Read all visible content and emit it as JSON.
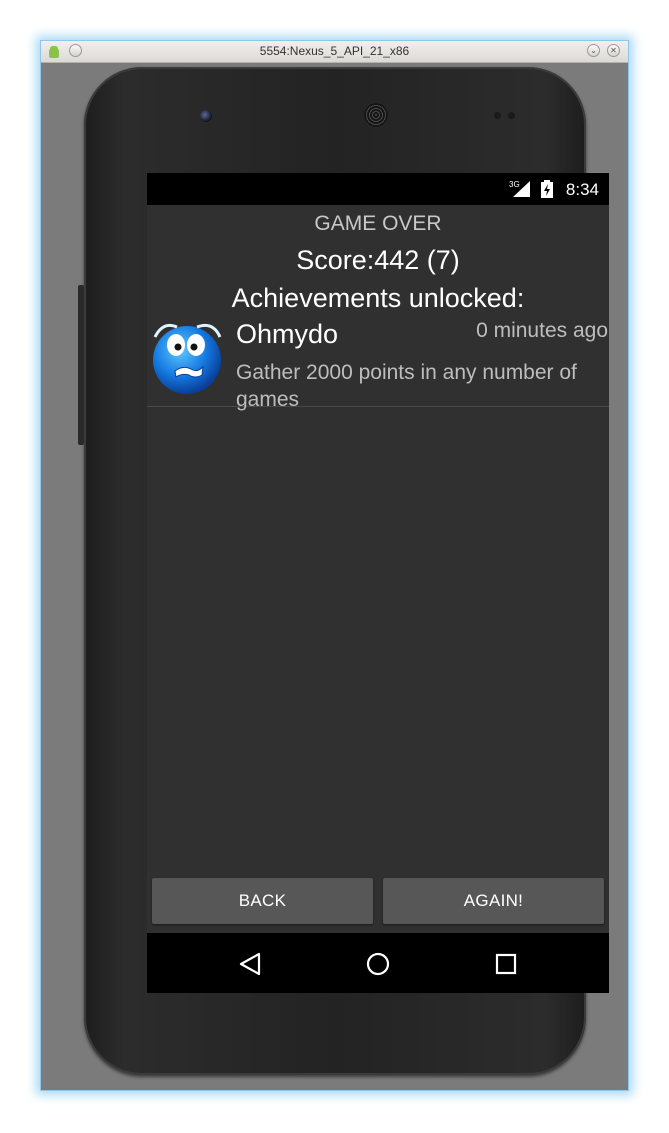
{
  "window": {
    "title": "5554:Nexus_5_API_21_x86",
    "icons": [
      "android-icon",
      "menu-circle-icon",
      "minimize-icon",
      "close-icon"
    ]
  },
  "status_bar": {
    "network": "3G",
    "time": "8:34",
    "icons": [
      "signal-icon",
      "battery-icon"
    ]
  },
  "game": {
    "heading": "GAME OVER",
    "score": "Score:442 (7)",
    "achievements_title": "Achievements unlocked:"
  },
  "achievements": [
    {
      "name": "Ohmydo",
      "time": "0 minutes ago",
      "description_line1": "Gather 2000 points in any number of",
      "description_line2": "games",
      "icon": "worried-smiley-icon"
    }
  ],
  "buttons": {
    "back": "BACK",
    "again": "AGAIN!"
  },
  "nav_bar": {
    "icons": [
      "back-triangle-icon",
      "home-circle-icon",
      "recents-square-icon"
    ]
  },
  "colors": {
    "screen_bg": "#303030",
    "button_bg": "#575757",
    "window_bg": "#7b7b7b",
    "window_glow": "#a9d9f5"
  }
}
